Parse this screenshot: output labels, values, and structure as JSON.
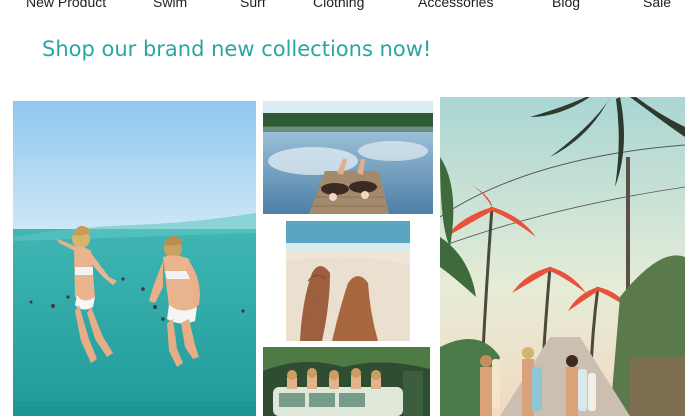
{
  "nav": {
    "items": [
      {
        "label": "New Product"
      },
      {
        "label": "Swim"
      },
      {
        "label": "Surf"
      },
      {
        "label": "Clothing"
      },
      {
        "label": "Accessories"
      },
      {
        "label": "Blog"
      },
      {
        "label": "Sale"
      }
    ]
  },
  "hero": {
    "headline": "Shop our brand new collections now!"
  },
  "colors": {
    "accent": "#2aa6a0",
    "nav_text": "#222222",
    "background": "#ffffff"
  }
}
